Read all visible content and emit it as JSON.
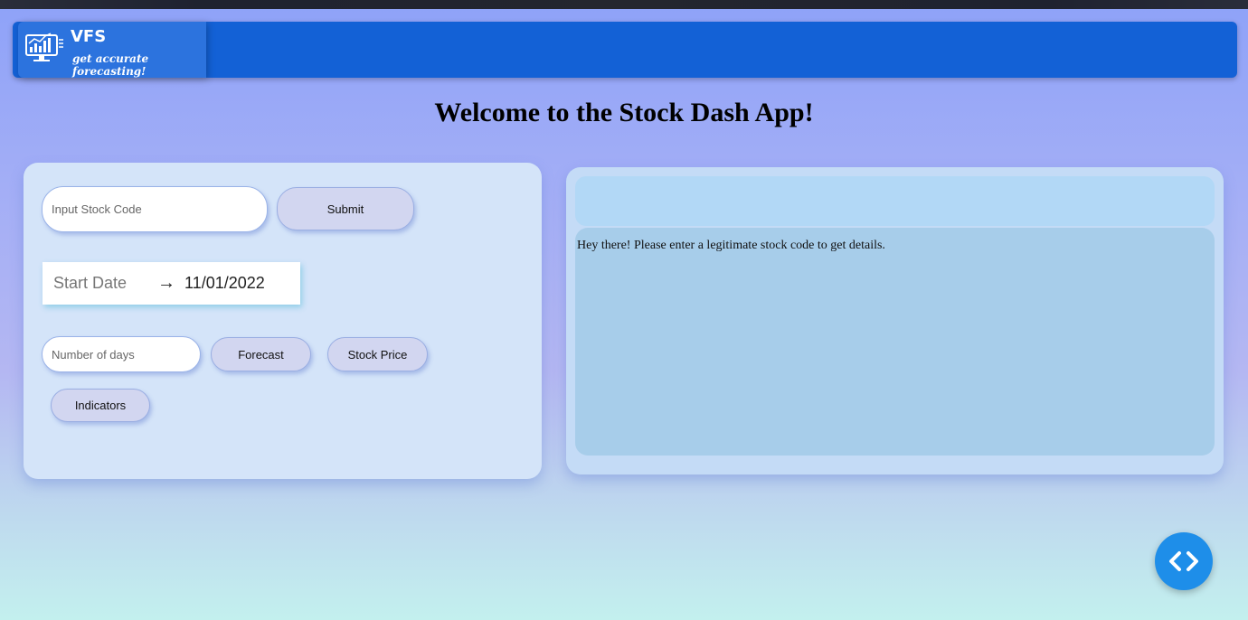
{
  "brand": {
    "name": "VFS",
    "tagline": "get accurate forecasting!"
  },
  "page": {
    "title": "Welcome to the Stock Dash App!"
  },
  "form": {
    "stock_code_placeholder": "Input Stock Code",
    "submit_label": "Submit",
    "start_date_label": "Start Date",
    "start_date_value": "11/01/2022",
    "days_placeholder": "Number of days",
    "forecast_label": "Forecast",
    "stock_price_label": "Stock Price",
    "indicators_label": "Indicators"
  },
  "output": {
    "header_text": "",
    "message": "Hey there! Please enter a legitimate stock code to get details."
  },
  "icons": {
    "logo": "chart-monitor-icon",
    "toggle": "code-brackets-icon"
  },
  "colors": {
    "navbar": "#1361d6",
    "brand_panel": "#2c73de",
    "toggle_button": "#1e8ee9"
  }
}
